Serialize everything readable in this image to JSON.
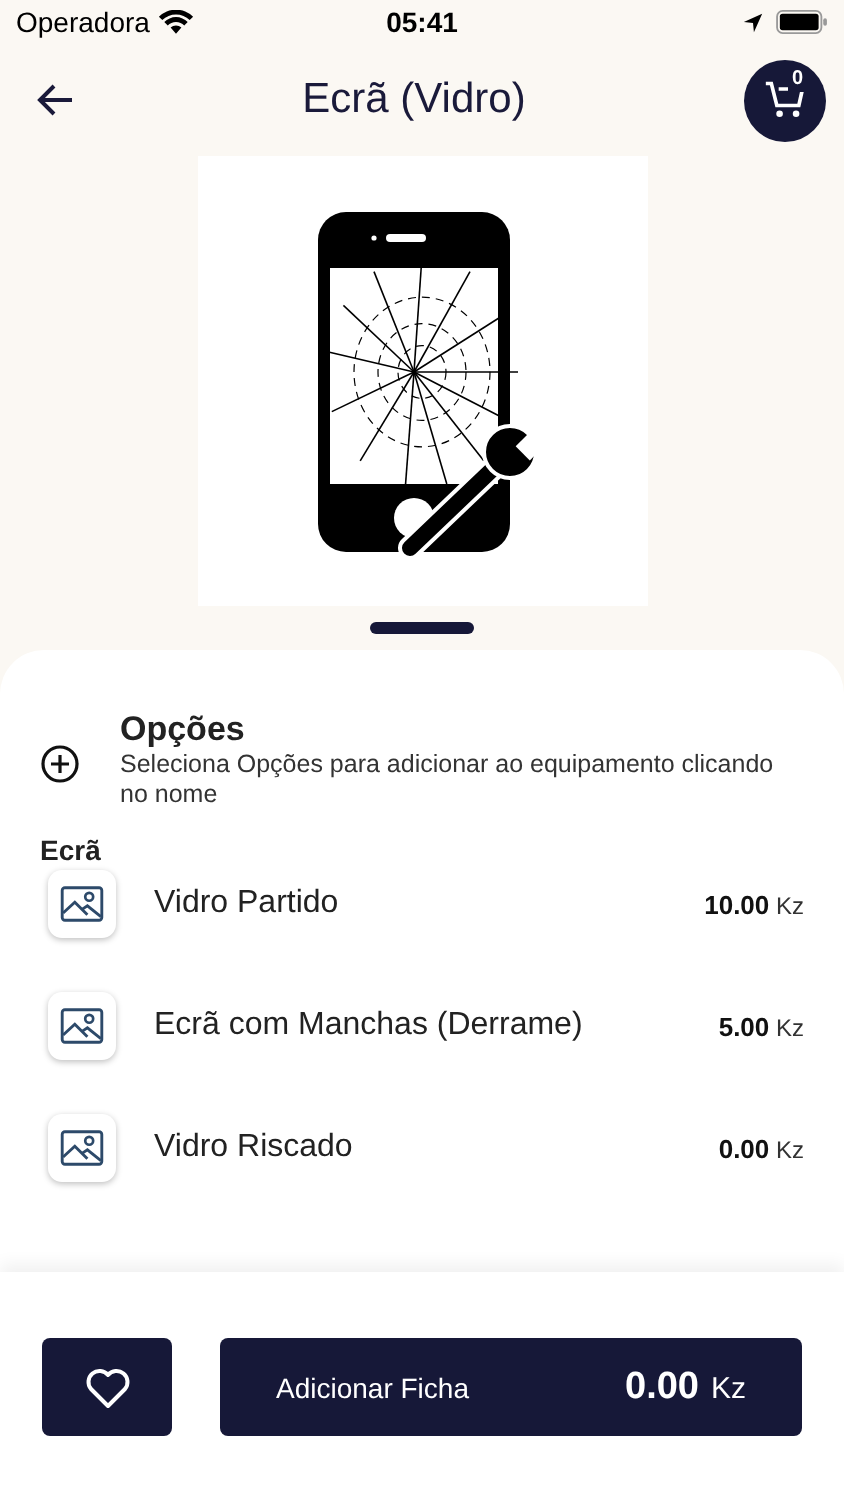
{
  "status_bar": {
    "carrier": "Operadora",
    "time": "05:41"
  },
  "header": {
    "title": "Ecrã (Vidro)",
    "cart_count": "0"
  },
  "gallery": {
    "pages": [
      {
        "selected": true
      }
    ]
  },
  "options": {
    "title": "Opções",
    "description": "Seleciona Opções para adicionar ao equipamento clicando no nome"
  },
  "section": "Ecrã",
  "items": [
    {
      "name": "Vidro Partido",
      "price": "**10.00** Kz"
    },
    {
      "name": "Ecrã com Manchas (Derrame)",
      "price": "**5.00** Kz"
    },
    {
      "name": "Vidro Riscado",
      "price": "**0.00** Kz"
    }
  ],
  "footer": {
    "button": "Adicionar Ficha",
    "total": "0.00",
    "currency": "Kz"
  }
}
